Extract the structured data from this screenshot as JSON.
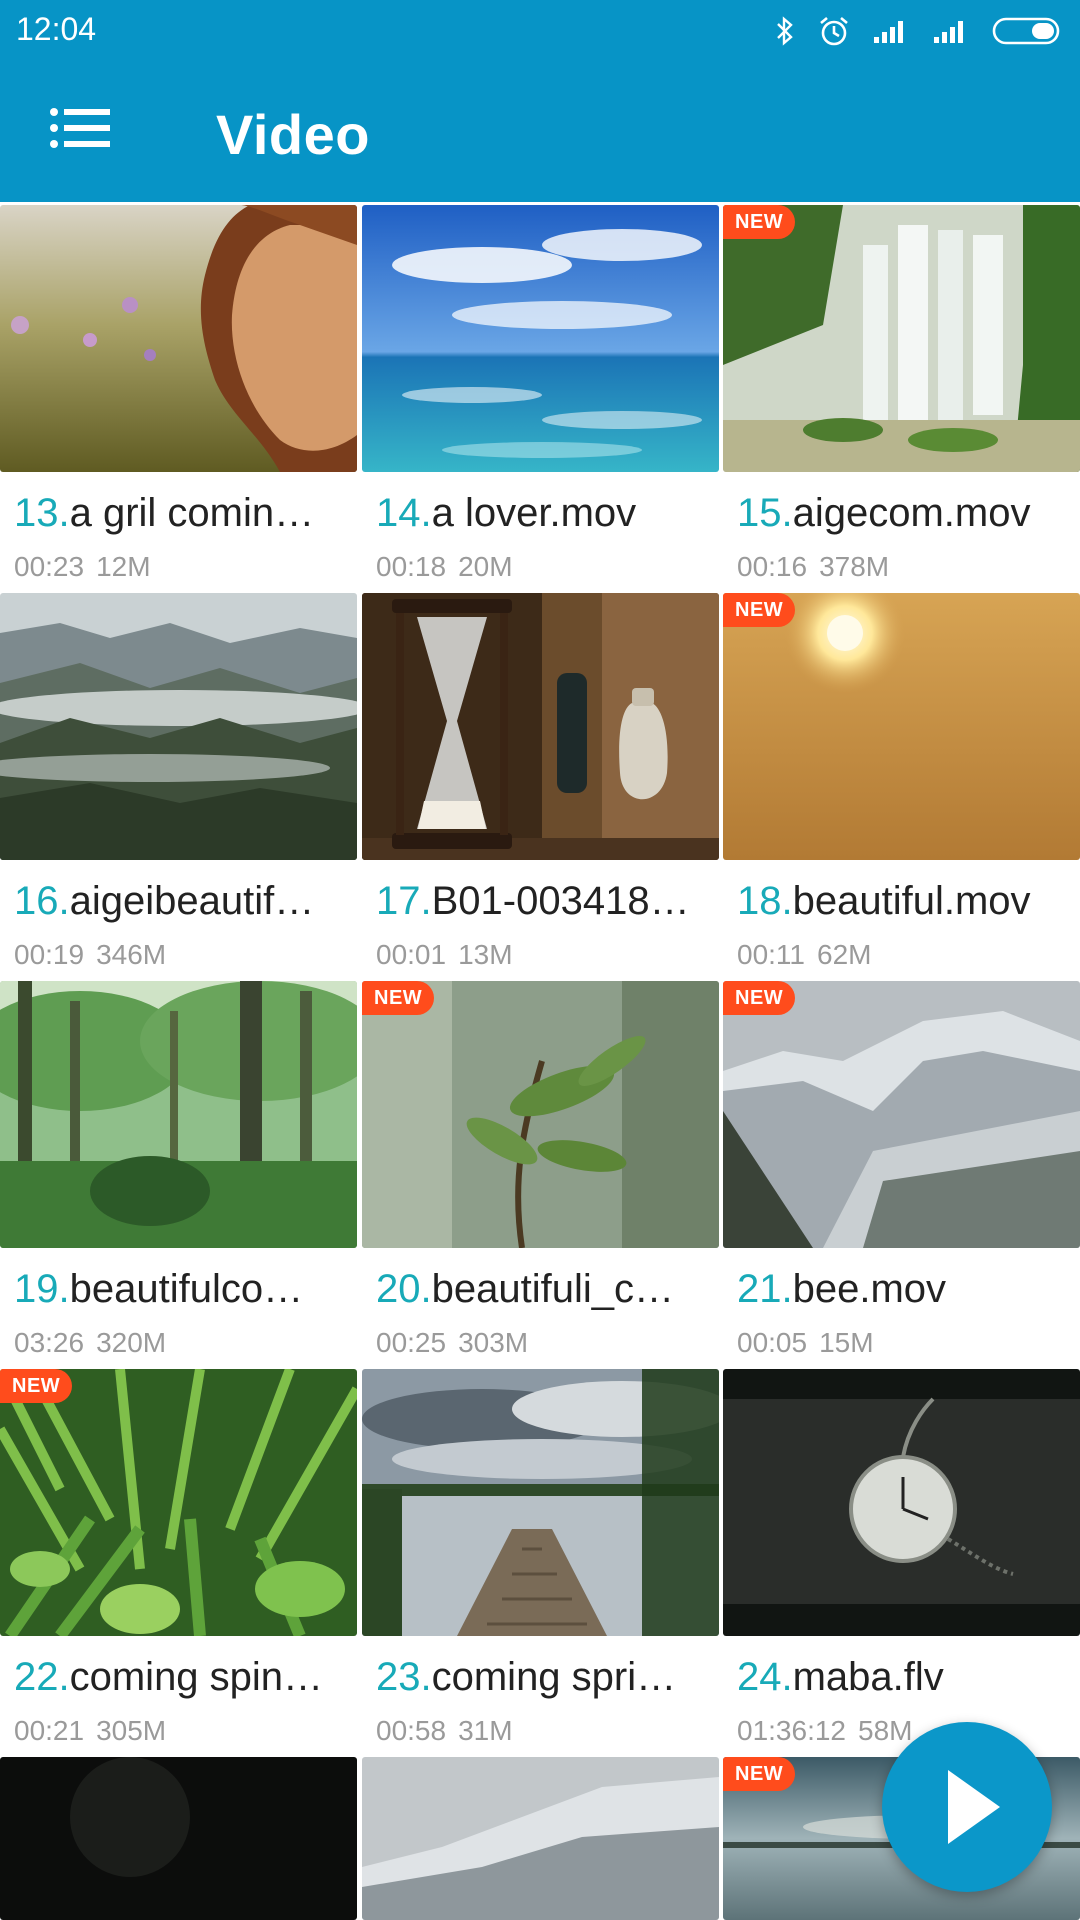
{
  "status_bar": {
    "time": "12:04",
    "icons": [
      "bluetooth-icon",
      "alarm-icon",
      "signal-icon",
      "signal-icon",
      "battery-icon"
    ]
  },
  "app_bar": {
    "menu_icon": "menu-list-icon",
    "title": "Video"
  },
  "colors": {
    "header": "#0794c6",
    "index_number": "#18aab8",
    "new_badge": "#ff4c1c",
    "fab": "#0b97c9"
  },
  "videos": [
    {
      "index": "13.",
      "name": "a gril comin…",
      "duration": "00:23",
      "size": "12M",
      "badge": ""
    },
    {
      "index": "14.",
      "name": "a lover.mov",
      "duration": "00:18",
      "size": "20M",
      "badge": ""
    },
    {
      "index": "15.",
      "name": "aigecom.mov",
      "duration": "00:16",
      "size": "378M",
      "badge": "NEW"
    },
    {
      "index": "16.",
      "name": "aigeibeautif…",
      "duration": "00:19",
      "size": "346M",
      "badge": ""
    },
    {
      "index": "17.",
      "name": "B01-003418…",
      "duration": "00:01",
      "size": "13M",
      "badge": ""
    },
    {
      "index": "18.",
      "name": "beautiful.mov",
      "duration": "00:11",
      "size": "62M",
      "badge": "NEW"
    },
    {
      "index": "19.",
      "name": "beautifulco…",
      "duration": "03:26",
      "size": "320M",
      "badge": ""
    },
    {
      "index": "20.",
      "name": "beautifuli_c…",
      "duration": "00:25",
      "size": "303M",
      "badge": "NEW"
    },
    {
      "index": "21.",
      "name": "bee.mov",
      "duration": "00:05",
      "size": "15M",
      "badge": "NEW"
    },
    {
      "index": "22.",
      "name": "coming spin…",
      "duration": "00:21",
      "size": "305M",
      "badge": "NEW"
    },
    {
      "index": "23.",
      "name": "coming spri…",
      "duration": "00:58",
      "size": "31M",
      "badge": ""
    },
    {
      "index": "24.",
      "name": "maba.flv",
      "duration": "01:36:12",
      "size": "58M",
      "badge": ""
    },
    {
      "index": "",
      "name": "",
      "duration": "",
      "size": "",
      "badge": ""
    },
    {
      "index": "",
      "name": "",
      "duration": "",
      "size": "",
      "badge": ""
    },
    {
      "index": "",
      "name": "",
      "duration": "",
      "size": "",
      "badge": "NEW"
    }
  ],
  "fab": {
    "icon": "play-icon"
  }
}
